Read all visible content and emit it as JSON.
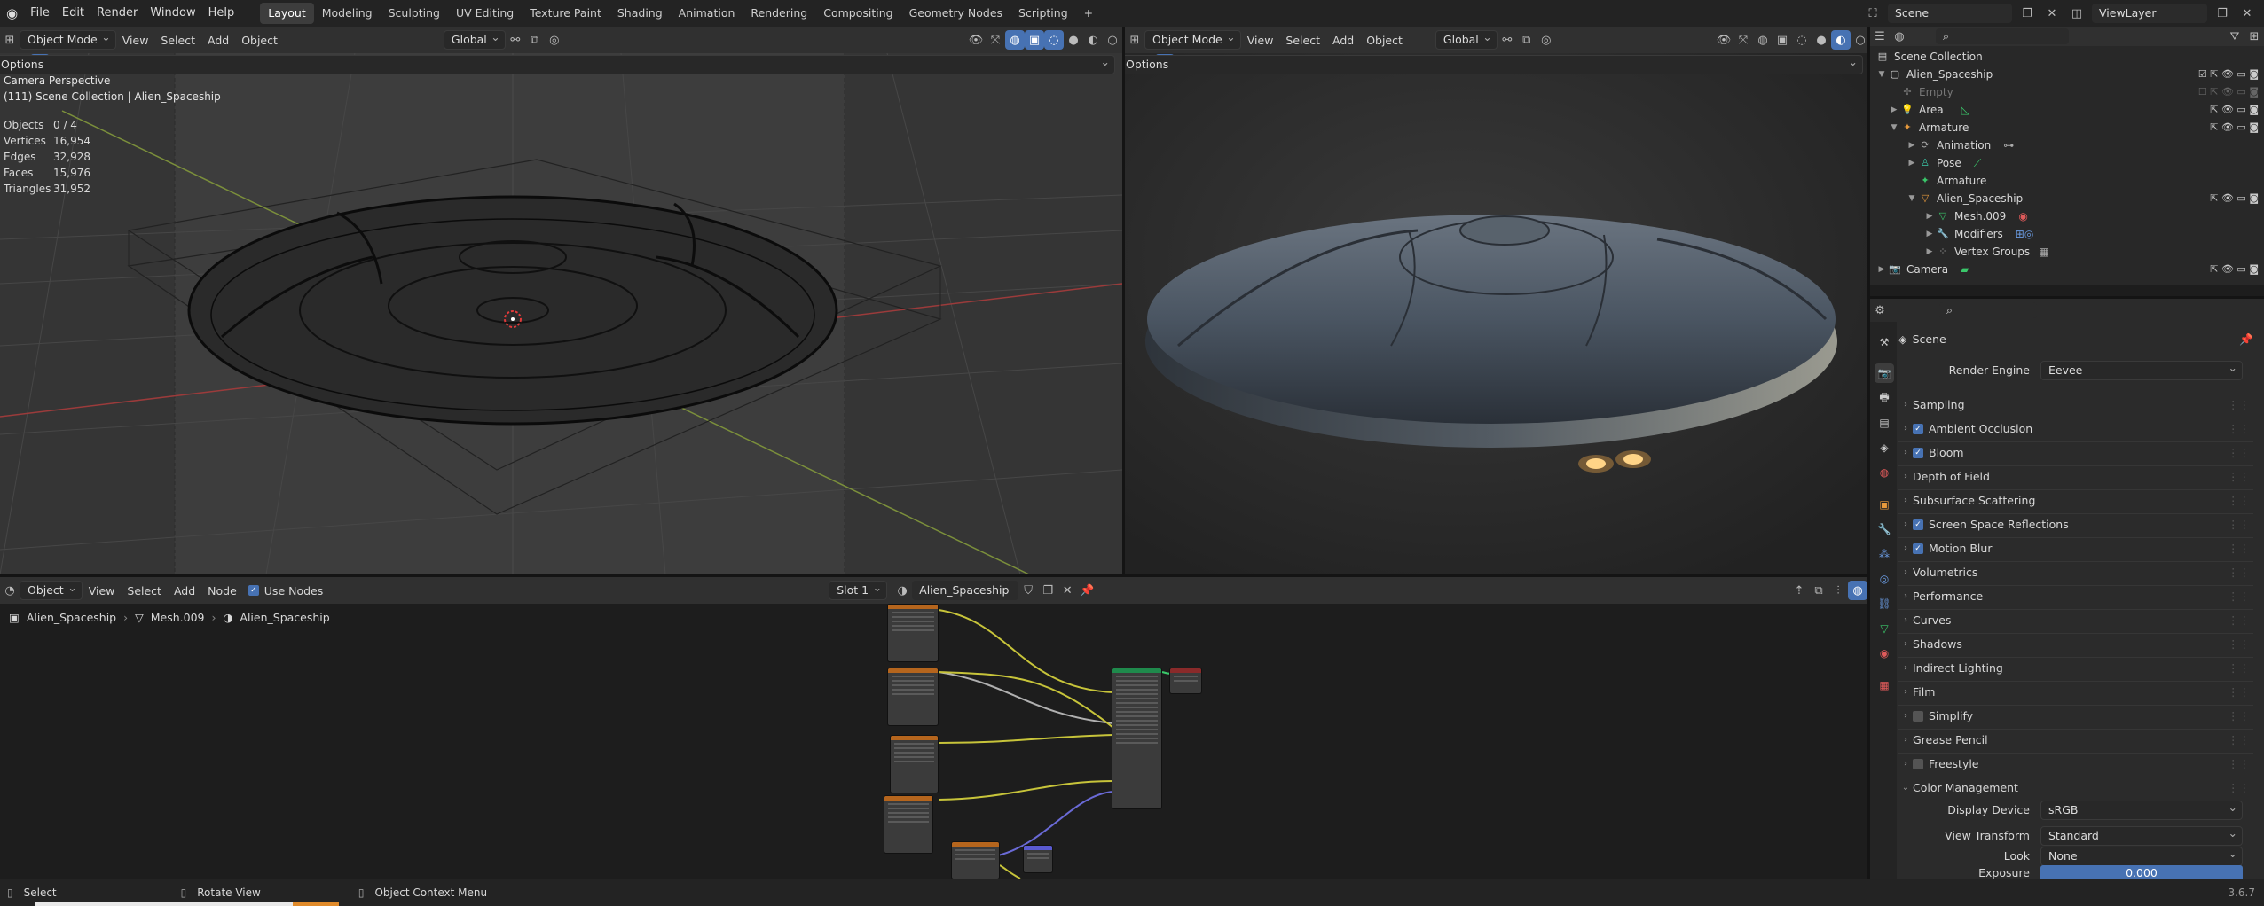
{
  "app": {
    "version": "3.6.7"
  },
  "topbar": {
    "menus": [
      "File",
      "Edit",
      "Render",
      "Window",
      "Help"
    ],
    "workspaces": [
      "Layout",
      "Modeling",
      "Sculpting",
      "UV Editing",
      "Texture Paint",
      "Shading",
      "Animation",
      "Rendering",
      "Compositing",
      "Geometry Nodes",
      "Scripting"
    ],
    "active_workspace": "Layout",
    "add_tab": "+",
    "scene": "Scene",
    "view_layer": "ViewLayer"
  },
  "viewport_left": {
    "mode": "Object Mode",
    "menus": [
      "View",
      "Select",
      "Add",
      "Object"
    ],
    "orientation": "Global",
    "options": "Options",
    "overlay_title": "Camera Perspective",
    "overlay_path": "(111) Scene Collection | Alien_Spaceship",
    "stats": [
      {
        "label": "Objects",
        "value": "0 / 4"
      },
      {
        "label": "Vertices",
        "value": "16,954"
      },
      {
        "label": "Edges",
        "value": "32,928"
      },
      {
        "label": "Faces",
        "value": "15,976"
      },
      {
        "label": "Triangles",
        "value": "31,952"
      }
    ]
  },
  "viewport_right": {
    "mode": "Object Mode",
    "menus": [
      "View",
      "Select",
      "Add",
      "Object"
    ],
    "orientation": "Global",
    "options": "Options"
  },
  "node_editor": {
    "editor_type": "Object",
    "menus": [
      "View",
      "Select",
      "Add",
      "Node"
    ],
    "use_nodes": "Use Nodes",
    "slot": "Slot 1",
    "material": "Alien_Spaceship",
    "breadcrumb": [
      "Alien_Spaceship",
      "Mesh.009",
      "Alien_Spaceship"
    ]
  },
  "outliner": {
    "rows": [
      {
        "label": "Scene Collection",
        "depth": 0
      },
      {
        "label": "Alien_Spaceship",
        "depth": 1
      },
      {
        "label": "Empty",
        "depth": 2
      },
      {
        "label": "Area",
        "depth": 2
      },
      {
        "label": "Armature",
        "depth": 2
      },
      {
        "label": "Animation",
        "depth": 3
      },
      {
        "label": "Pose",
        "depth": 3
      },
      {
        "label": "Armature",
        "depth": 3
      },
      {
        "label": "Alien_Spaceship",
        "depth": 3
      },
      {
        "label": "Mesh.009",
        "depth": 4
      },
      {
        "label": "Modifiers",
        "depth": 4
      },
      {
        "label": "Vertex Groups",
        "depth": 4
      },
      {
        "label": "Camera",
        "depth": 1
      }
    ]
  },
  "properties": {
    "context": "Scene",
    "render_engine_label": "Render Engine",
    "render_engine": "Eevee",
    "panels": [
      {
        "label": "Sampling",
        "checkbox": null
      },
      {
        "label": "Ambient Occlusion",
        "checkbox": true
      },
      {
        "label": "Bloom",
        "checkbox": true
      },
      {
        "label": "Depth of Field",
        "checkbox": null
      },
      {
        "label": "Subsurface Scattering",
        "checkbox": null
      },
      {
        "label": "Screen Space Reflections",
        "checkbox": true
      },
      {
        "label": "Motion Blur",
        "checkbox": true
      },
      {
        "label": "Volumetrics",
        "checkbox": null
      },
      {
        "label": "Performance",
        "checkbox": null
      },
      {
        "label": "Curves",
        "checkbox": null
      },
      {
        "label": "Shadows",
        "checkbox": null
      },
      {
        "label": "Indirect Lighting",
        "checkbox": null
      },
      {
        "label": "Film",
        "checkbox": null
      },
      {
        "label": "Simplify",
        "checkbox": false
      },
      {
        "label": "Grease Pencil",
        "checkbox": null
      },
      {
        "label": "Freestyle",
        "checkbox": false
      },
      {
        "label": "Color Management",
        "checkbox": null
      }
    ],
    "color_management": [
      {
        "label": "Display Device",
        "value": "sRGB"
      },
      {
        "label": "View Transform",
        "value": "Standard"
      },
      {
        "label": "Look",
        "value": "None"
      },
      {
        "label": "Exposure",
        "value": "0.000"
      }
    ]
  },
  "statusbar": {
    "items": [
      "Select",
      "Rotate View",
      "Object Context Menu"
    ],
    "version": "3.6.7"
  }
}
